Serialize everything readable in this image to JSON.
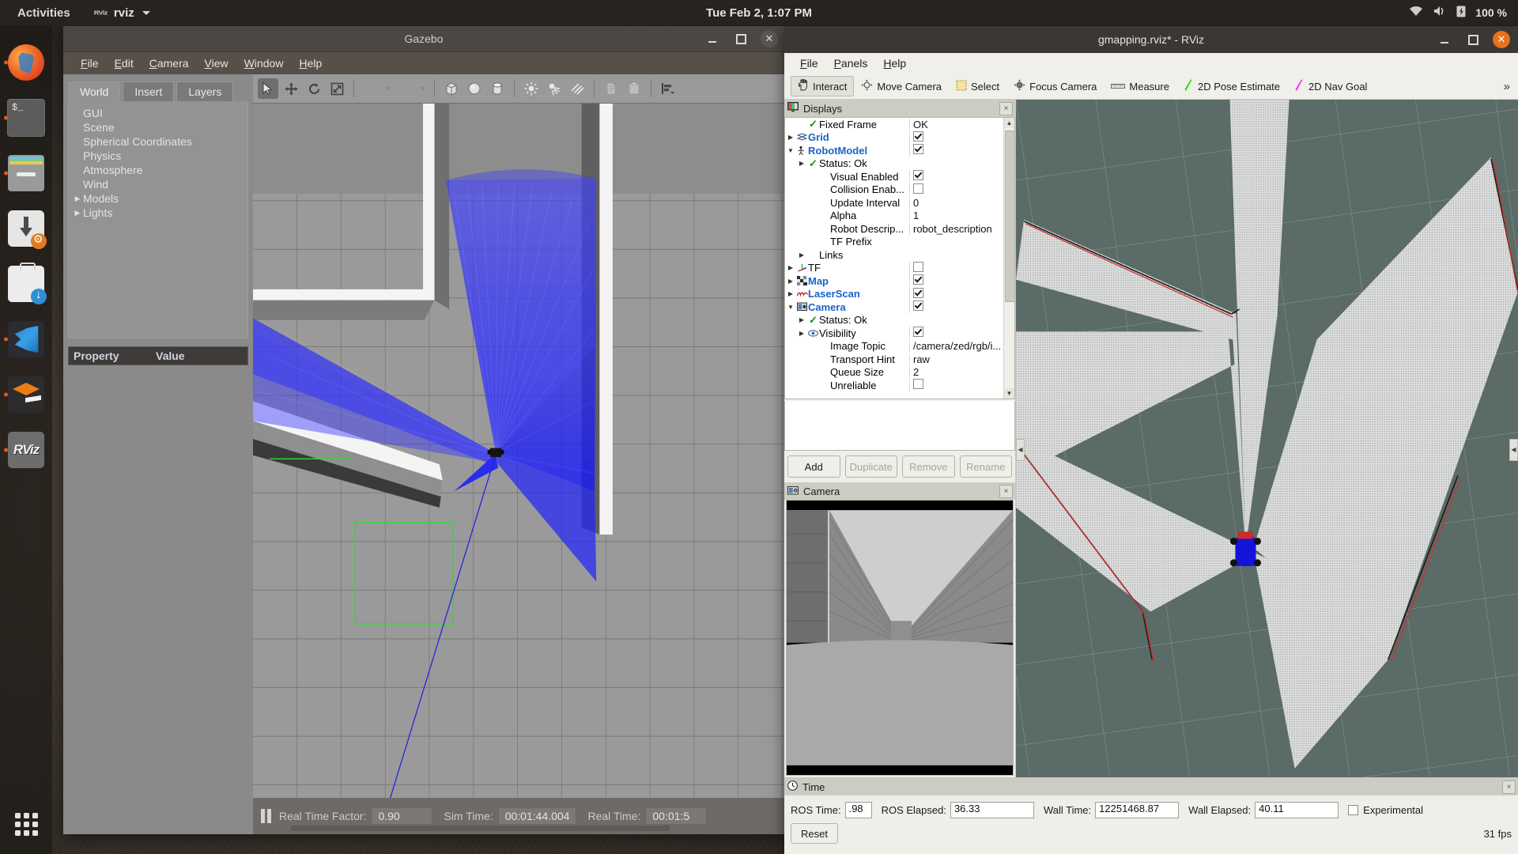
{
  "topbar": {
    "activities": "Activities",
    "app_icon": "RViz",
    "app_name": "rviz",
    "clock": "Tue Feb 2,  1:07 PM",
    "battery_pct": "100 %",
    "icons": [
      "wifi-icon",
      "volume-icon",
      "battery-icon"
    ]
  },
  "dock": {
    "items": [
      {
        "name": "firefox",
        "running": true
      },
      {
        "name": "terminal",
        "running": true
      },
      {
        "name": "files",
        "running": true
      },
      {
        "name": "software-install",
        "running": false
      },
      {
        "name": "software-updater",
        "running": false
      },
      {
        "name": "vscode",
        "running": true
      },
      {
        "name": "virtualbox",
        "running": true
      },
      {
        "name": "rviz",
        "running": true
      }
    ],
    "show_apps": "show-applications"
  },
  "gazebo": {
    "title": "Gazebo",
    "menu": [
      "File",
      "Edit",
      "Camera",
      "View",
      "Window",
      "Help"
    ],
    "tabs": [
      {
        "label": "World",
        "active": true
      },
      {
        "label": "Insert",
        "active": false
      },
      {
        "label": "Layers",
        "active": false
      }
    ],
    "tree": [
      {
        "label": "GUI",
        "expandable": false
      },
      {
        "label": "Scene",
        "expandable": false
      },
      {
        "label": "Spherical Coordinates",
        "expandable": false
      },
      {
        "label": "Physics",
        "expandable": false
      },
      {
        "label": "Atmosphere",
        "expandable": false
      },
      {
        "label": "Wind",
        "expandable": false
      },
      {
        "label": "Models",
        "expandable": true
      },
      {
        "label": "Lights",
        "expandable": true
      }
    ],
    "property_header": {
      "property": "Property",
      "value": "Value"
    },
    "toolbar_icons": [
      "select-arrow-icon",
      "translate-icon",
      "rotate-icon",
      "scale-icon",
      "undo-icon",
      "redo-icon",
      "box-icon",
      "sphere-icon",
      "cylinder-icon",
      "point-light-icon",
      "spot-light-icon",
      "directional-light-icon",
      "copy-icon",
      "paste-icon",
      "align-icon"
    ],
    "status": {
      "pause_label": "pause-button",
      "rtf_label": "Real Time Factor:",
      "rtf_value": "0.90",
      "sim_label": "Sim Time:",
      "sim_value": "00:01:44.004",
      "real_label": "Real Time:",
      "real_value": "00:01:5"
    }
  },
  "rviz": {
    "title": "gmapping.rviz* - RViz",
    "menu": [
      "File",
      "Panels",
      "Help"
    ],
    "toolbar": [
      {
        "label": "Interact",
        "icon": "hand-icon",
        "active": true
      },
      {
        "label": "Move Camera",
        "icon": "move-camera-icon",
        "active": false
      },
      {
        "label": "Select",
        "icon": "select-box-icon",
        "active": false
      },
      {
        "label": "Focus Camera",
        "icon": "focus-camera-icon",
        "active": false
      },
      {
        "label": "Measure",
        "icon": "ruler-icon",
        "active": false
      },
      {
        "label": "2D Pose Estimate",
        "icon": "green-arrow-icon",
        "active": false
      },
      {
        "label": "2D Nav Goal",
        "icon": "magenta-arrow-icon",
        "active": false
      }
    ],
    "toolbar_overflow": "»",
    "displays_panel": {
      "title": "Displays",
      "icon": "displays-icon",
      "close": "×",
      "rows": [
        {
          "indent": 1,
          "arrow": "",
          "icon": "check",
          "label": "Fixed Frame",
          "value_type": "text",
          "value": "OK",
          "blue": false
        },
        {
          "indent": 0,
          "arrow": "▶",
          "icon": "grid",
          "label": "Grid",
          "value_type": "check",
          "value": "on",
          "blue": true
        },
        {
          "indent": 0,
          "arrow": "▼",
          "icon": "robot",
          "label": "RobotModel",
          "value_type": "check",
          "value": "on",
          "blue": true
        },
        {
          "indent": 1,
          "arrow": "▶",
          "icon": "check",
          "label": "Status: Ok",
          "value_type": "none",
          "value": "",
          "blue": false
        },
        {
          "indent": 2,
          "arrow": "",
          "icon": "",
          "label": "Visual Enabled",
          "value_type": "check",
          "value": "on",
          "blue": false
        },
        {
          "indent": 2,
          "arrow": "",
          "icon": "",
          "label": "Collision Enab...",
          "value_type": "check",
          "value": "off",
          "blue": false
        },
        {
          "indent": 2,
          "arrow": "",
          "icon": "",
          "label": "Update Interval",
          "value_type": "text",
          "value": "0",
          "blue": false
        },
        {
          "indent": 2,
          "arrow": "",
          "icon": "",
          "label": "Alpha",
          "value_type": "text",
          "value": "1",
          "blue": false
        },
        {
          "indent": 2,
          "arrow": "",
          "icon": "",
          "label": "Robot Descrip...",
          "value_type": "text",
          "value": "robot_description",
          "blue": false
        },
        {
          "indent": 2,
          "arrow": "",
          "icon": "",
          "label": "TF Prefix",
          "value_type": "text",
          "value": "",
          "blue": false
        },
        {
          "indent": 1,
          "arrow": "▶",
          "icon": "",
          "label": "Links",
          "value_type": "none",
          "value": "",
          "blue": false
        },
        {
          "indent": 0,
          "arrow": "▶",
          "icon": "tf",
          "label": "TF",
          "value_type": "check",
          "value": "off",
          "blue": false
        },
        {
          "indent": 0,
          "arrow": "▶",
          "icon": "map",
          "label": "Map",
          "value_type": "check",
          "value": "on",
          "blue": true
        },
        {
          "indent": 0,
          "arrow": "▶",
          "icon": "laser",
          "label": "LaserScan",
          "value_type": "check",
          "value": "on",
          "blue": true
        },
        {
          "indent": 0,
          "arrow": "▼",
          "icon": "camera",
          "label": "Camera",
          "value_type": "check",
          "value": "on",
          "blue": true
        },
        {
          "indent": 1,
          "arrow": "▶",
          "icon": "check",
          "label": "Status: Ok",
          "value_type": "none",
          "value": "",
          "blue": false
        },
        {
          "indent": 1,
          "arrow": "▶",
          "icon": "eye",
          "label": "Visibility",
          "value_type": "check",
          "value": "on",
          "blue": false
        },
        {
          "indent": 2,
          "arrow": "",
          "icon": "",
          "label": "Image Topic",
          "value_type": "text",
          "value": "/camera/zed/rgb/i...",
          "blue": false
        },
        {
          "indent": 2,
          "arrow": "",
          "icon": "",
          "label": "Transport Hint",
          "value_type": "text",
          "value": "raw",
          "blue": false
        },
        {
          "indent": 2,
          "arrow": "",
          "icon": "",
          "label": "Queue Size",
          "value_type": "text",
          "value": "2",
          "blue": false
        },
        {
          "indent": 2,
          "arrow": "",
          "icon": "",
          "label": "Unreliable",
          "value_type": "check",
          "value": "off",
          "blue": false
        }
      ],
      "buttons": [
        {
          "label": "Add",
          "enabled": true
        },
        {
          "label": "Duplicate",
          "enabled": false
        },
        {
          "label": "Remove",
          "enabled": false
        },
        {
          "label": "Rename",
          "enabled": false
        }
      ]
    },
    "camera_panel": {
      "title": "Camera",
      "icon": "camera-icon",
      "close": "×"
    },
    "time_panel": {
      "title": "Time",
      "icon": "clock-icon",
      "close": "×",
      "ros_time_label": "ROS Time:",
      "ros_time_value": ".98",
      "ros_elapsed_label": "ROS Elapsed:",
      "ros_elapsed_value": "36.33",
      "wall_time_label": "Wall Time:",
      "wall_time_value": "12251468.87",
      "wall_elapsed_label": "Wall Elapsed:",
      "wall_elapsed_value": "40.11",
      "experimental_label": "Experimental",
      "experimental_checked": false,
      "reset_label": "Reset",
      "fps": "31 fps"
    }
  }
}
